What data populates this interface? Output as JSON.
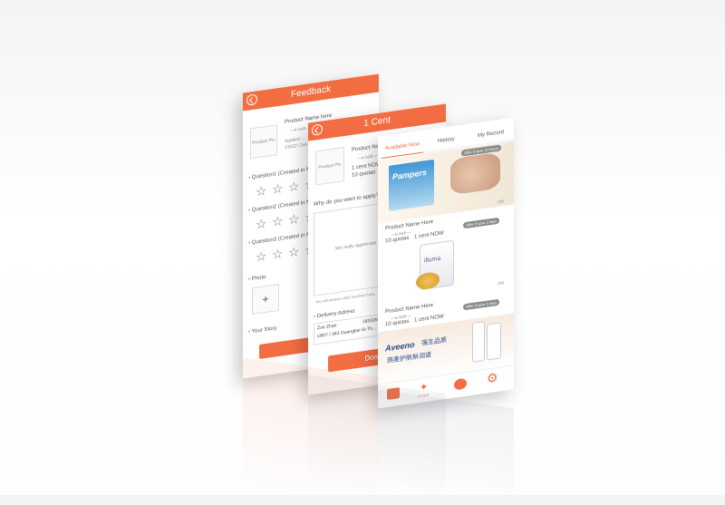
{
  "feedback": {
    "title": "Feedback",
    "product_name": "Product Name here",
    "pic_label": "Product Pic",
    "sub": "—e.sub—",
    "applied": "Applied ...",
    "code": "13222 Cand...",
    "q1": "Question1 (Created in M...",
    "q2": "Question2 (Created in M...",
    "q3": "Question3 (Created in M...",
    "photo": "Photo",
    "add": "+",
    "story": "Your Story",
    "submit": "S"
  },
  "onecent": {
    "title": "1 Cent",
    "product_name": "Product Name here",
    "pic_label": "Product Pic",
    "sub": "—e.sub—",
    "cent_now": "1 cent NOW",
    "quotas": "10 quotas",
    "why": "Why do you want to apply?",
    "placeholder": "We really appreciate you...",
    "receive": "You will receive a $10 Voucher if you...",
    "delivery": "Delivery Adress",
    "name": "Zoe Zhan",
    "phone": "18332826...",
    "address": "U807 / 343 Guangbei St Th...",
    "donate": "Donate 1 Cen"
  },
  "main": {
    "tabs": [
      "Available Now",
      "History",
      "My Record"
    ],
    "offers": [
      {
        "expire": "Offer Expire 10 hours",
        "name": "",
        "line": "",
        "count": "(34)"
      },
      {
        "name": "Product Name Here",
        "sub": "—e.sub—",
        "quotas": "10 quotas",
        "cent": "1 cent NOW",
        "expire": "Offer Expire 3 days",
        "count": "(34)"
      },
      {
        "name": "Product Name Here",
        "sub": "—e.sub—",
        "quotas": "10 quotas",
        "cent": "1 cent NOW",
        "expire": "Offer Expire 3 days",
        "count": ""
      }
    ],
    "brands": {
      "pampers": "Pampers",
      "aveeno": "Aveeno",
      "aveeno_cn": "强生品质",
      "aveeno_cn2": "燕麦护肤新润道",
      "illuma": "illuma"
    },
    "bottom_nav": [
      {
        "label": "",
        "icon": "sale-icon"
      },
      {
        "label": "1 Cent",
        "icon": "tag-icon"
      },
      {
        "label": "",
        "icon": "chat-icon"
      },
      {
        "label": "",
        "icon": "gear-icon"
      }
    ]
  }
}
